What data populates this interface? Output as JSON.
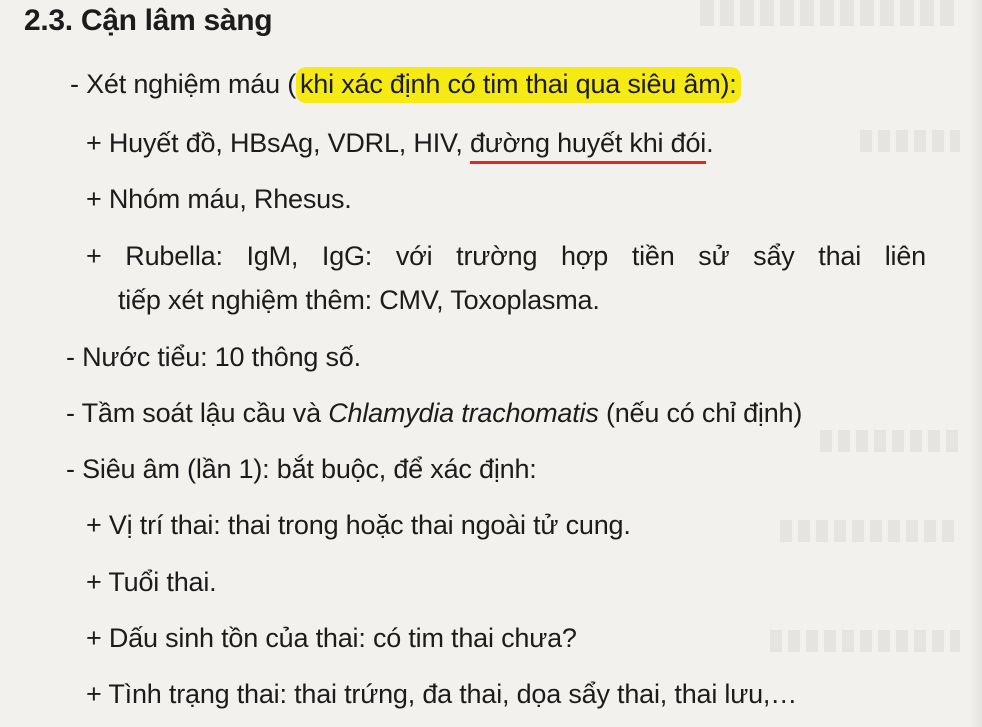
{
  "section": {
    "heading": "2.3. Cận lâm sàng"
  },
  "items": {
    "blood_test_prefix": "- Xét nghiệm máu (",
    "blood_test_highlight": "khi xác định có tim thai qua siêu âm):",
    "blood_panel_prefix": "+ Huyết đồ, HBsAg, VDRL, HIV, ",
    "blood_panel_underlined": "đường huyết khi đói",
    "blood_panel_suffix": ".",
    "blood_group": "+ Nhóm máu, Rhesus.",
    "rubella_line1": "+ Rubella: IgM, IgG: với trường hợp tiền sử sẩy thai liên",
    "rubella_line2": "tiếp xét nghiệm thêm: CMV, Toxoplasma.",
    "urine": "- Nước tiểu: 10 thông số.",
    "screening_prefix": "- Tầm soát lậu cầu và ",
    "screening_italic": "Chlamydia trachomatis",
    "screening_suffix": " (nếu có chỉ định)",
    "ultrasound": "- Siêu âm (lần 1): bắt buộc, để xác định:",
    "us_position": "+ Vị trí thai: thai trong hoặc thai ngoài tử cung.",
    "us_age": "+ Tuổi thai.",
    "us_vital": "+ Dấu sinh tồn của thai: có tim thai chưa?",
    "us_status": "+ Tình trạng thai: thai trứng, đa thai, dọa sẩy thai, thai lưu,…"
  },
  "colors": {
    "highlight": "#f6ea14",
    "underline": "#e0261f",
    "paper": "#f3f1ee",
    "ink": "#1c1c1c"
  }
}
